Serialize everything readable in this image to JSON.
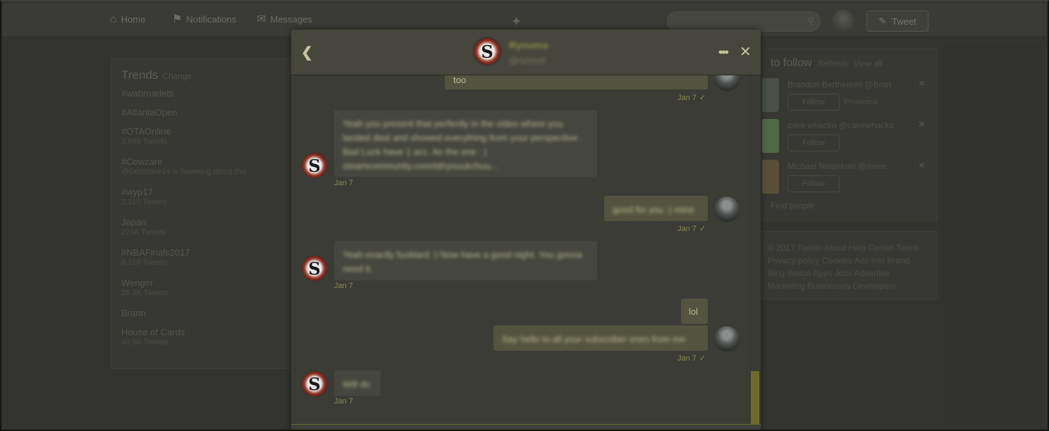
{
  "topbar": {
    "nav": [
      {
        "label": "Home",
        "icon": "home-icon"
      },
      {
        "label": "Notifications",
        "icon": "bell-icon"
      },
      {
        "label": "Messages",
        "icon": "envelope-icon"
      }
    ],
    "tweet_label": "Tweet"
  },
  "trends": {
    "title": "Trends",
    "change": "Change",
    "items": [
      {
        "name": "#wabroadets",
        "sub": ""
      },
      {
        "name": "#AtlantaOpen",
        "sub": ""
      },
      {
        "name": "#OTAOnline",
        "sub": "3,849 Tweets"
      },
      {
        "name": "#Cowzare",
        "sub": "@Detective14 is Tweeting about this"
      },
      {
        "name": "#wyp17",
        "sub": "2,310 Tweets"
      },
      {
        "name": "Japan",
        "sub": "275K Tweets"
      },
      {
        "name": "#NBAFinals2017",
        "sub": "8,318 Tweets"
      },
      {
        "name": "Wenger",
        "sub": "25.3K Tweets"
      },
      {
        "name": "Brann",
        "sub": ""
      },
      {
        "name": "House of Cards",
        "sub": "40.8K Tweets"
      }
    ]
  },
  "who_to_follow": {
    "title": "to follow",
    "refresh": "Refresh",
    "view_all": "View all",
    "items": [
      {
        "name": "Brandon Berthelsen @Bran",
        "follow": "Follow",
        "promoted": "Promoted"
      },
      {
        "name": "cake whacko @cakewhacko",
        "follow": "Follow",
        "promoted": ""
      },
      {
        "name": "Michael Nwankwo @mnse",
        "follow": "Follow",
        "promoted": ""
      }
    ],
    "find_people": "Find people"
  },
  "footer": {
    "text": "© 2017 Twitter  About  Help Center  Terms  Privacy policy  Cookies  Ads info  Brand  Blog  Status  Apps  Jobs  Advertise  Marketing  Businesses  Developers"
  },
  "modal": {
    "contact_name": "Ryouma",
    "contact_handle": "@ryouuli",
    "messages": [
      {
        "dir": "out",
        "text": "too",
        "time": "Jan 7"
      },
      {
        "dir": "in",
        "text": "Yeah you present that perfectly in the video where you landed died and showed everything from your perspective . Bad Luck have 1 acc. As the one : ) steamcommunity.com/id/ryouukchuu...",
        "time": "Jan 7"
      },
      {
        "dir": "out",
        "text": "good for you :) mine",
        "time": "Jan 7"
      },
      {
        "dir": "in",
        "text": "Yeah exactly fucktard :) Now have a good night. You gonna need it.",
        "time": "Jan 7"
      },
      {
        "dir": "out",
        "text": "lol",
        "time": ""
      },
      {
        "dir": "out",
        "text": "Say hello to all your subscriber ones from me",
        "time": "Jan 7"
      },
      {
        "dir": "in",
        "text": "Will do",
        "time": "Jan 7"
      }
    ]
  }
}
